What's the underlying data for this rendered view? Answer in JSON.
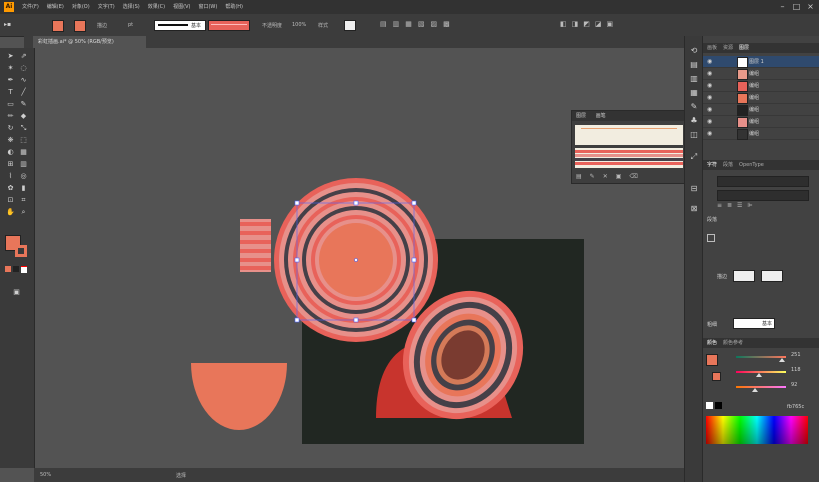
{
  "app": {
    "logo": "Ai"
  },
  "menu": [
    "文件(F)",
    "编辑(E)",
    "对象(O)",
    "文字(T)",
    "选择(S)",
    "效果(C)",
    "视图(V)",
    "窗口(W)",
    "帮助(H)"
  ],
  "control_bar": {
    "fill_color": "#e8765a",
    "stroke_color": "#e8765a",
    "stroke_label": "描边",
    "stroke_weight": "pt",
    "brush_label": "基本",
    "opacity_label": "不透明度",
    "opacity_value": "100%",
    "style_label": "样式"
  },
  "document_tab": {
    "title": "彩虹插画.ai* @ 50% (RGB/预览)"
  },
  "status_bar": {
    "zoom": "50%",
    "mode": "选择"
  },
  "floating_panel": {
    "title": "图层",
    "tab2": "画笔"
  },
  "right_panel": {
    "top_tabs": [
      "图层",
      "画板",
      "资源"
    ],
    "layers": [
      {
        "name": "图层 1"
      },
      {
        "name": "编组"
      },
      {
        "name": "编组"
      },
      {
        "name": "编组"
      },
      {
        "name": "编组"
      },
      {
        "name": "编组"
      },
      {
        "name": "编组"
      }
    ],
    "char_tabs": [
      "字符",
      "段落",
      "OpenType"
    ],
    "align_label": "段落",
    "stroke_section_label": "描边",
    "weight_label": "粗细",
    "weight_value": "基本",
    "color_tabs": [
      "颜色",
      "颜色参考"
    ],
    "rgb": {
      "r": "251",
      "g": "118",
      "b": "92",
      "hex": "fb765c"
    }
  },
  "colors": {
    "accent": "#e8765a",
    "ring_dark": "#454048",
    "ring_pink": "#e7908a",
    "ring_red": "#e8625a",
    "artboard": "#212722"
  },
  "icons": [
    "selection-tool-icon",
    "direct-selection-icon",
    "pen-icon",
    "type-icon",
    "line-icon",
    "rectangle-icon",
    "brush-icon",
    "pencil-icon",
    "eraser-icon",
    "rotate-icon",
    "scale-icon",
    "warp-icon",
    "gradient-icon",
    "eyedropper-icon",
    "blend-icon",
    "symbol-icon",
    "graph-icon",
    "artboard-tool-icon",
    "slice-icon",
    "hand-icon",
    "zoom-icon",
    "eye-icon",
    "lock-icon"
  ]
}
